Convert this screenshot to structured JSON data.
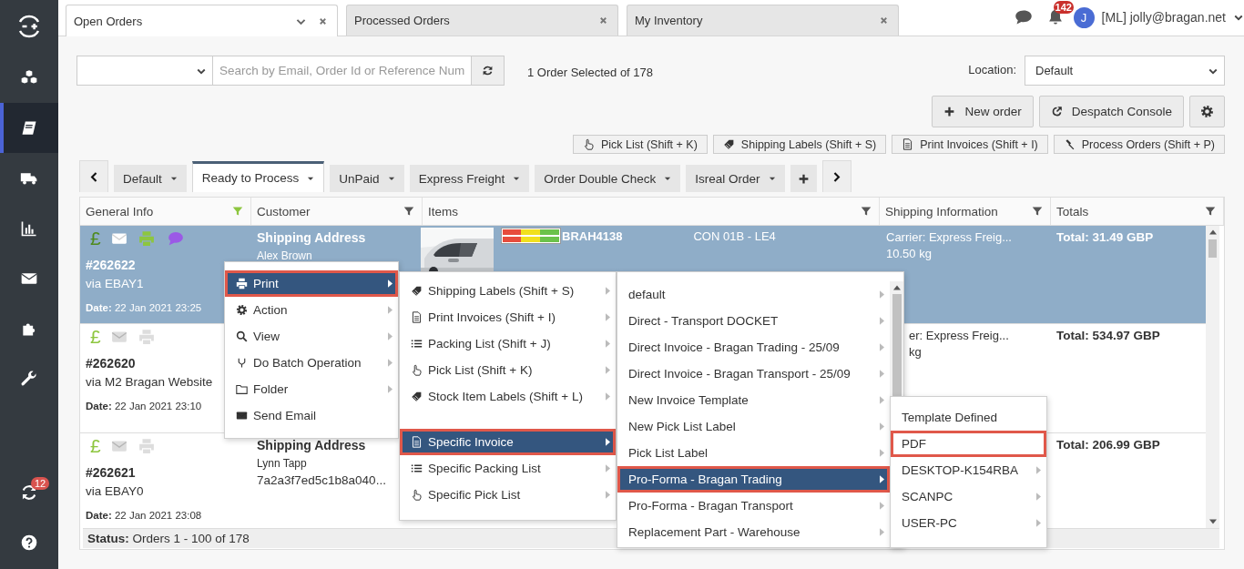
{
  "sidebar": {
    "items": [
      {
        "selected": false
      },
      {
        "selected": true
      },
      {
        "selected": false
      },
      {
        "selected": false
      },
      {
        "selected": false
      },
      {
        "selected": false
      },
      {
        "selected": false
      }
    ],
    "sync_badge": "12"
  },
  "window_tabs": [
    {
      "label": "Open Orders",
      "selected": true
    },
    {
      "label": "Processed Orders",
      "selected": false
    },
    {
      "label": "My Inventory",
      "selected": false
    }
  ],
  "header": {
    "notifications": "142",
    "avatar": "J",
    "user": "[ML] jolly@bragan.net"
  },
  "toolbar": {
    "search_placeholder": "Search by Email, Order Id or Reference Num",
    "selection_info": "1 Order Selected of 178",
    "location_label": "Location:",
    "location_value": "Default"
  },
  "actions": [
    "New order",
    "Despatch Console"
  ],
  "quick_actions": [
    "Pick List (Shift + K)",
    "Shipping Labels (Shift + S)",
    "Print Invoices (Shift + I)",
    "Process Orders (Shift + P)"
  ],
  "view_tabs": [
    {
      "label": "Default",
      "selected": false
    },
    {
      "label": "Ready to Process",
      "selected": true
    },
    {
      "label": "UnPaid",
      "selected": false
    },
    {
      "label": "Express Freight",
      "selected": false
    },
    {
      "label": "Order Double Check",
      "selected": false
    },
    {
      "label": "Isreal Order",
      "selected": false
    }
  ],
  "table": {
    "columns": [
      {
        "label": "General Info",
        "filter_active": true
      },
      {
        "label": "Customer",
        "filter_active": false
      },
      {
        "label": "Items",
        "filter_active": false
      },
      {
        "label": "Shipping Information",
        "filter_active": false
      },
      {
        "label": "Totals",
        "filter_active": false
      }
    ],
    "rows": [
      {
        "selected": true,
        "paid_symbol": "£",
        "printed": true,
        "has_notes": true,
        "order": "#262622",
        "channel": "via EBAY1",
        "date": "**Date:** 22 Jan 2021 23:25",
        "customer_title": "Shipping Address",
        "customer_name": "Alex Brown",
        "item": {
          "sku": "BRAH4138",
          "location": "CON 01B - LE4"
        },
        "shipping": [
          "Carrier: Express Freig...",
          "10.50 kg"
        ],
        "total": "Total: 31.49 GBP"
      },
      {
        "selected": false,
        "paid_symbol": "£",
        "printed": false,
        "has_notes": false,
        "order": "#262620",
        "channel": "via M2 Bragan Website",
        "date": "**Date:** 22 Jan 2021 23:10",
        "shipping": [
          "er: Express Freig...",
          "kg"
        ],
        "total": "Total: 534.97 GBP"
      },
      {
        "selected": false,
        "paid_symbol": "£",
        "printed": false,
        "has_notes": false,
        "order": "#262621",
        "channel": "via EBAY0",
        "date": "**Date:** 22 Jan 2021 23:08",
        "customer_title": "Shipping Address",
        "customer_name": "Lynn Tapp",
        "customer_extra": "7a2a3f7ed5c1b8a040...",
        "total": "Total: 206.99 GBP"
      }
    ],
    "status": "**Status:** Orders 1 - 100 of 178"
  },
  "context_menus": [
    {
      "items": [
        {
          "kind": "item",
          "label": "Print",
          "selected": true,
          "highlighted": true,
          "submenu": true
        },
        {
          "kind": "item",
          "label": "Action",
          "selected": false,
          "highlighted": false,
          "submenu": true
        },
        {
          "kind": "item",
          "label": "View",
          "selected": false,
          "highlighted": false,
          "submenu": true
        },
        {
          "kind": "item",
          "label": "Do Batch Operation",
          "selected": false,
          "highlighted": false,
          "submenu": true
        },
        {
          "kind": "item",
          "label": "Folder",
          "selected": false,
          "highlighted": false,
          "submenu": true
        },
        {
          "kind": "item",
          "label": "Send Email",
          "selected": false,
          "highlighted": false,
          "submenu": false
        }
      ]
    },
    {
      "items": [
        {
          "kind": "item",
          "label": "Shipping Labels (Shift + S)",
          "selected": false,
          "highlighted": false,
          "submenu": true
        },
        {
          "kind": "item",
          "label": "Print Invoices (Shift + I)",
          "selected": false,
          "highlighted": false,
          "submenu": true
        },
        {
          "kind": "item",
          "label": "Packing List (Shift + J)",
          "selected": false,
          "highlighted": false,
          "submenu": true
        },
        {
          "kind": "item",
          "label": "Pick List (Shift + K)",
          "selected": false,
          "highlighted": false,
          "submenu": true
        },
        {
          "kind": "item",
          "label": "Stock Item Labels (Shift + L)",
          "selected": false,
          "highlighted": false,
          "submenu": true
        },
        {
          "kind": "separator"
        },
        {
          "kind": "item",
          "label": "Specific Invoice",
          "selected": true,
          "highlighted": true,
          "submenu": true
        },
        {
          "kind": "item",
          "label": "Specific Packing List",
          "selected": false,
          "highlighted": false,
          "submenu": true
        },
        {
          "kind": "item",
          "label": "Specific Pick List",
          "selected": false,
          "highlighted": false,
          "submenu": true
        }
      ]
    },
    {
      "items": [
        {
          "kind": "item",
          "label": "default",
          "selected": false,
          "highlighted": false,
          "submenu": true
        },
        {
          "kind": "item",
          "label": "Direct - Transport DOCKET",
          "selected": false,
          "highlighted": false,
          "submenu": true
        },
        {
          "kind": "item",
          "label": "Direct Invoice - Bragan Trading - 25/09",
          "selected": false,
          "highlighted": false,
          "submenu": true
        },
        {
          "kind": "item",
          "label": "Direct Invoice - Bragan Transport - 25/09",
          "selected": false,
          "highlighted": false,
          "submenu": true
        },
        {
          "kind": "item",
          "label": "New Invoice Template",
          "selected": false,
          "highlighted": false,
          "submenu": true
        },
        {
          "kind": "item",
          "label": "New Pick List Label",
          "selected": false,
          "highlighted": false,
          "submenu": true
        },
        {
          "kind": "item",
          "label": "Pick List Label",
          "selected": false,
          "highlighted": false,
          "submenu": true
        },
        {
          "kind": "item",
          "label": "Pro-Forma - Bragan Trading",
          "selected": true,
          "highlighted": true,
          "submenu": true
        },
        {
          "kind": "item",
          "label": "Pro-Forma - Bragan Transport",
          "selected": false,
          "highlighted": false,
          "submenu": true
        },
        {
          "kind": "item",
          "label": "Replacement Part - Warehouse",
          "selected": false,
          "highlighted": false,
          "submenu": true
        }
      ]
    },
    {
      "items": [
        {
          "kind": "item",
          "label": "Template Defined",
          "selected": false,
          "highlighted": false,
          "submenu": false
        },
        {
          "kind": "item",
          "label": "PDF",
          "selected": false,
          "highlighted": true,
          "submenu": false
        },
        {
          "kind": "item",
          "label": "DESKTOP-K154RBA",
          "selected": false,
          "highlighted": false,
          "submenu": true
        },
        {
          "kind": "item",
          "label": "SCANPC",
          "selected": false,
          "highlighted": false,
          "submenu": true
        },
        {
          "kind": "item",
          "label": "USER-PC",
          "selected": false,
          "highlighted": false,
          "submenu": true
        }
      ]
    }
  ]
}
